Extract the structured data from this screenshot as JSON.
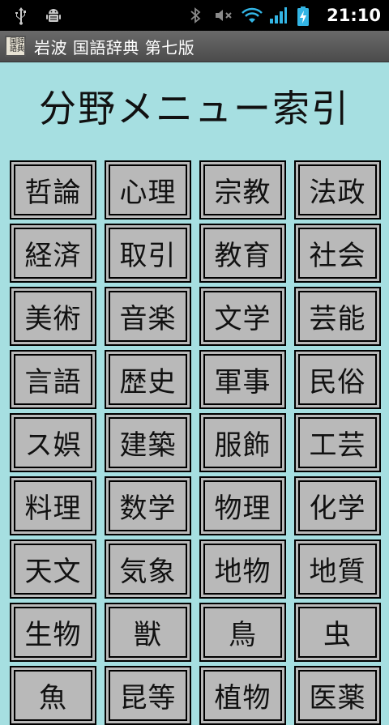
{
  "status_bar": {
    "time": "21:10",
    "icons": [
      "usb-icon",
      "android-debug-icon",
      "bluetooth-icon",
      "mute-icon",
      "wifi-icon",
      "signal-icon",
      "battery-charging-icon"
    ]
  },
  "title_bar": {
    "app_icon_text": "辞典国語",
    "title": "岩波 国語辞典 第七版"
  },
  "heading": "分野メニュー索引",
  "categories": [
    "哲論",
    "心理",
    "宗教",
    "法政",
    "経済",
    "取引",
    "教育",
    "社会",
    "美術",
    "音楽",
    "文学",
    "芸能",
    "言語",
    "歴史",
    "軍事",
    "民俗",
    "ス娯",
    "建築",
    "服飾",
    "工芸",
    "料理",
    "数学",
    "物理",
    "化学",
    "天文",
    "気象",
    "地物",
    "地質",
    "生物",
    "獣",
    "鳥",
    "虫",
    "魚",
    "昆等",
    "植物",
    "医薬"
  ],
  "colors": {
    "background": "#a6dfe1",
    "button_face": "#b9b9b9",
    "status_bar": "#000000",
    "title_bar": "#555555"
  }
}
